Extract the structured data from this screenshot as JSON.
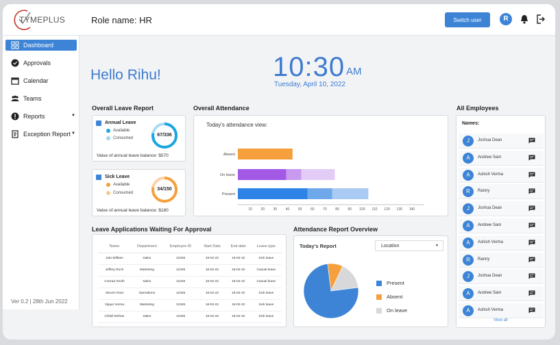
{
  "header": {
    "logo_text": "TYMEPLUS",
    "role": "Role name: HR",
    "switch_user": "Switch user",
    "avatar_initial": "R"
  },
  "sidebar": {
    "items": [
      {
        "label": "Dashboard",
        "icon": "dashboard-icon"
      },
      {
        "label": "Approvals",
        "icon": "check-badge-icon"
      },
      {
        "label": "Calendar",
        "icon": "calendar-icon"
      },
      {
        "label": "Teams",
        "icon": "people-icon"
      },
      {
        "label": "Reports",
        "icon": "alert-icon"
      },
      {
        "label": "Exception Report",
        "icon": "document-icon"
      }
    ],
    "version": "Ver 0.2 | 28th Jun 2022"
  },
  "greeting": "Hello Rihu!",
  "clock": {
    "time": "10:30",
    "ampm": "AM",
    "date": "Tuesday, April 10, 2022"
  },
  "leave_report": {
    "title": "Overall Leave Report",
    "annual": {
      "name": "Annual Leave",
      "available": "Available",
      "consumed": "Consumed",
      "ratio": "67/336",
      "fraction": 0.199,
      "balance": "Value of annual leave balance: $570"
    },
    "sick": {
      "name": "Sick Leave",
      "available": "Available",
      "consumed": "Consumed",
      "ratio": "34/150",
      "fraction": 0.227,
      "balance": "Value of annual leave balance: $180"
    }
  },
  "attendance": {
    "title": "Overall  Attendance",
    "subtitle": "Today's attendance view:",
    "chart_data": {
      "type": "bar",
      "orientation": "horizontal",
      "categories": [
        "Absent",
        "On leave",
        "Present"
      ],
      "series": [
        {
          "values": [
            44,
            39,
            56
          ]
        },
        {
          "values": [
            0,
            12,
            20
          ]
        },
        {
          "values": [
            0,
            27,
            29
          ]
        }
      ],
      "xticks": [
        "10",
        "20",
        "30",
        "40",
        "50",
        "60",
        "70",
        "80",
        "90",
        "100",
        "110",
        "120",
        "130",
        "140"
      ],
      "xlim": [
        0,
        150
      ]
    }
  },
  "leave_apps": {
    "title": "Leave Applications Waiting For Approval",
    "columns": [
      "Name",
      "Department",
      "Employee ID",
      "Start Date",
      "End date",
      "Leave type"
    ],
    "rows": [
      [
        "Jula William",
        "Sales",
        "12345",
        "16-02-22",
        "16-02-22",
        "Sick leave"
      ],
      [
        "Jeffery Roch",
        "Marketing",
        "12345",
        "16-02-22",
        "16-02-22",
        "Casual leave"
      ],
      [
        "Conrad Smith",
        "Sales",
        "12345",
        "16-02-22",
        "16-02-22",
        "Casual leave"
      ],
      [
        "Steven Rust",
        "Operations",
        "12345",
        "16-02-22",
        "16-02-22",
        "Sick leave"
      ],
      [
        "Vijaya Verma",
        "Marketing",
        "12345",
        "16-02-22",
        "16-02-22",
        "Sick leave"
      ],
      [
        "Chitsil Mohan",
        "Sales",
        "12345",
        "16-02-22",
        "16-02-22",
        "Sick leave"
      ]
    ]
  },
  "att_overview": {
    "title": "Attendance Report Overview",
    "report_title": "Today's Report",
    "location": "Location",
    "legend": [
      "Present",
      "Absent",
      "On leave"
    ],
    "colors": {
      "present": "#3d84d6",
      "absent": "#f5a03c",
      "on_leave": "#d8d8da"
    },
    "chart_data": {
      "type": "pie",
      "categories": [
        "Present",
        "Absent",
        "On leave"
      ],
      "values": [
        75,
        9,
        16
      ]
    }
  },
  "employees": {
    "title": "All Employees",
    "names_label": "Names:",
    "list": [
      {
        "initial": "J",
        "name": "Joshua Dean"
      },
      {
        "initial": "A",
        "name": "Andrew Sam"
      },
      {
        "initial": "A",
        "name": "Ashish Verma"
      },
      {
        "initial": "R",
        "name": "Ranny"
      },
      {
        "initial": "J",
        "name": "Joshua Dean"
      },
      {
        "initial": "A",
        "name": "Andrew Sam"
      },
      {
        "initial": "A",
        "name": "Ashish Verma"
      },
      {
        "initial": "R",
        "name": "Ranny"
      },
      {
        "initial": "J",
        "name": "Joshua Dean"
      },
      {
        "initial": "A",
        "name": "Andrew Sam"
      },
      {
        "initial": "A",
        "name": "Ashish Verma"
      }
    ],
    "view_all": "View all"
  }
}
